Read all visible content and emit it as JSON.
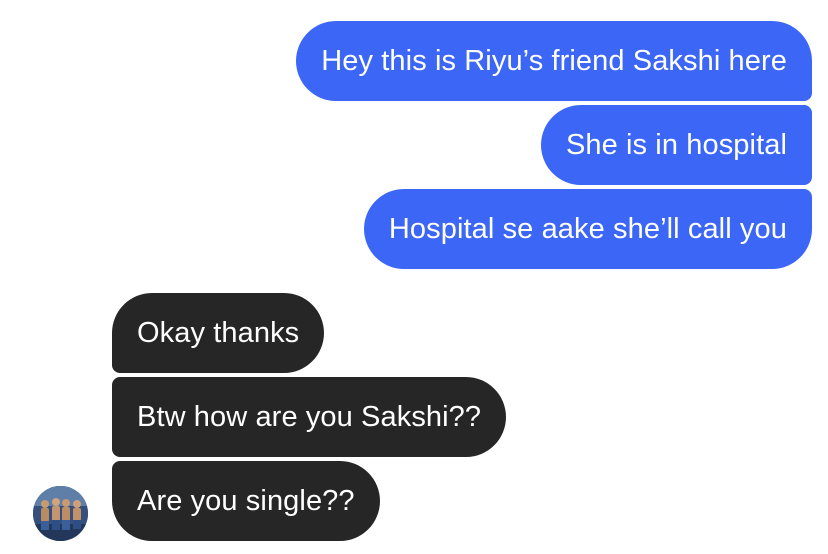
{
  "conversation": {
    "messages": [
      {
        "direction": "outgoing",
        "text": "Hey this is Riyu’s friend Sakshi here"
      },
      {
        "direction": "outgoing",
        "text": "She is in hospital"
      },
      {
        "direction": "outgoing",
        "text": "Hospital se aake she’ll call you"
      },
      {
        "direction": "incoming",
        "text": "Okay thanks"
      },
      {
        "direction": "incoming",
        "text": "Btw how are you Sakshi??"
      },
      {
        "direction": "incoming",
        "text": "Are you single??"
      }
    ]
  },
  "colors": {
    "outgoing_bubble": "#3b66f6",
    "incoming_bubble": "#262626",
    "background": "#ffffff"
  },
  "icons": {
    "sender_avatar": "contact-avatar-photo"
  }
}
